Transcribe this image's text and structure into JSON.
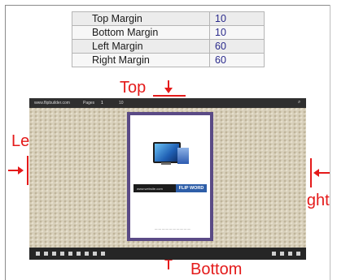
{
  "settings": [
    {
      "name": "Top Margin",
      "value": "10"
    },
    {
      "name": "Bottom Margin",
      "value": "10"
    },
    {
      "name": "Left Margin",
      "value": "60"
    },
    {
      "name": "Right Margin",
      "value": "60"
    }
  ],
  "annotations": {
    "top": "Top",
    "bottom": "Bottom",
    "left": "Left",
    "right": "Right"
  },
  "viewer": {
    "site": "www.flipbuilder.com",
    "pages_label": "Pages",
    "page_num": "1",
    "page_total": "10",
    "banner_url": "www.website.com",
    "banner_brand": "FLIP WORD"
  },
  "colors": {
    "annotation": "#e41a1a",
    "page_border": "#5a4a86",
    "value_text": "#2a2a8c"
  }
}
